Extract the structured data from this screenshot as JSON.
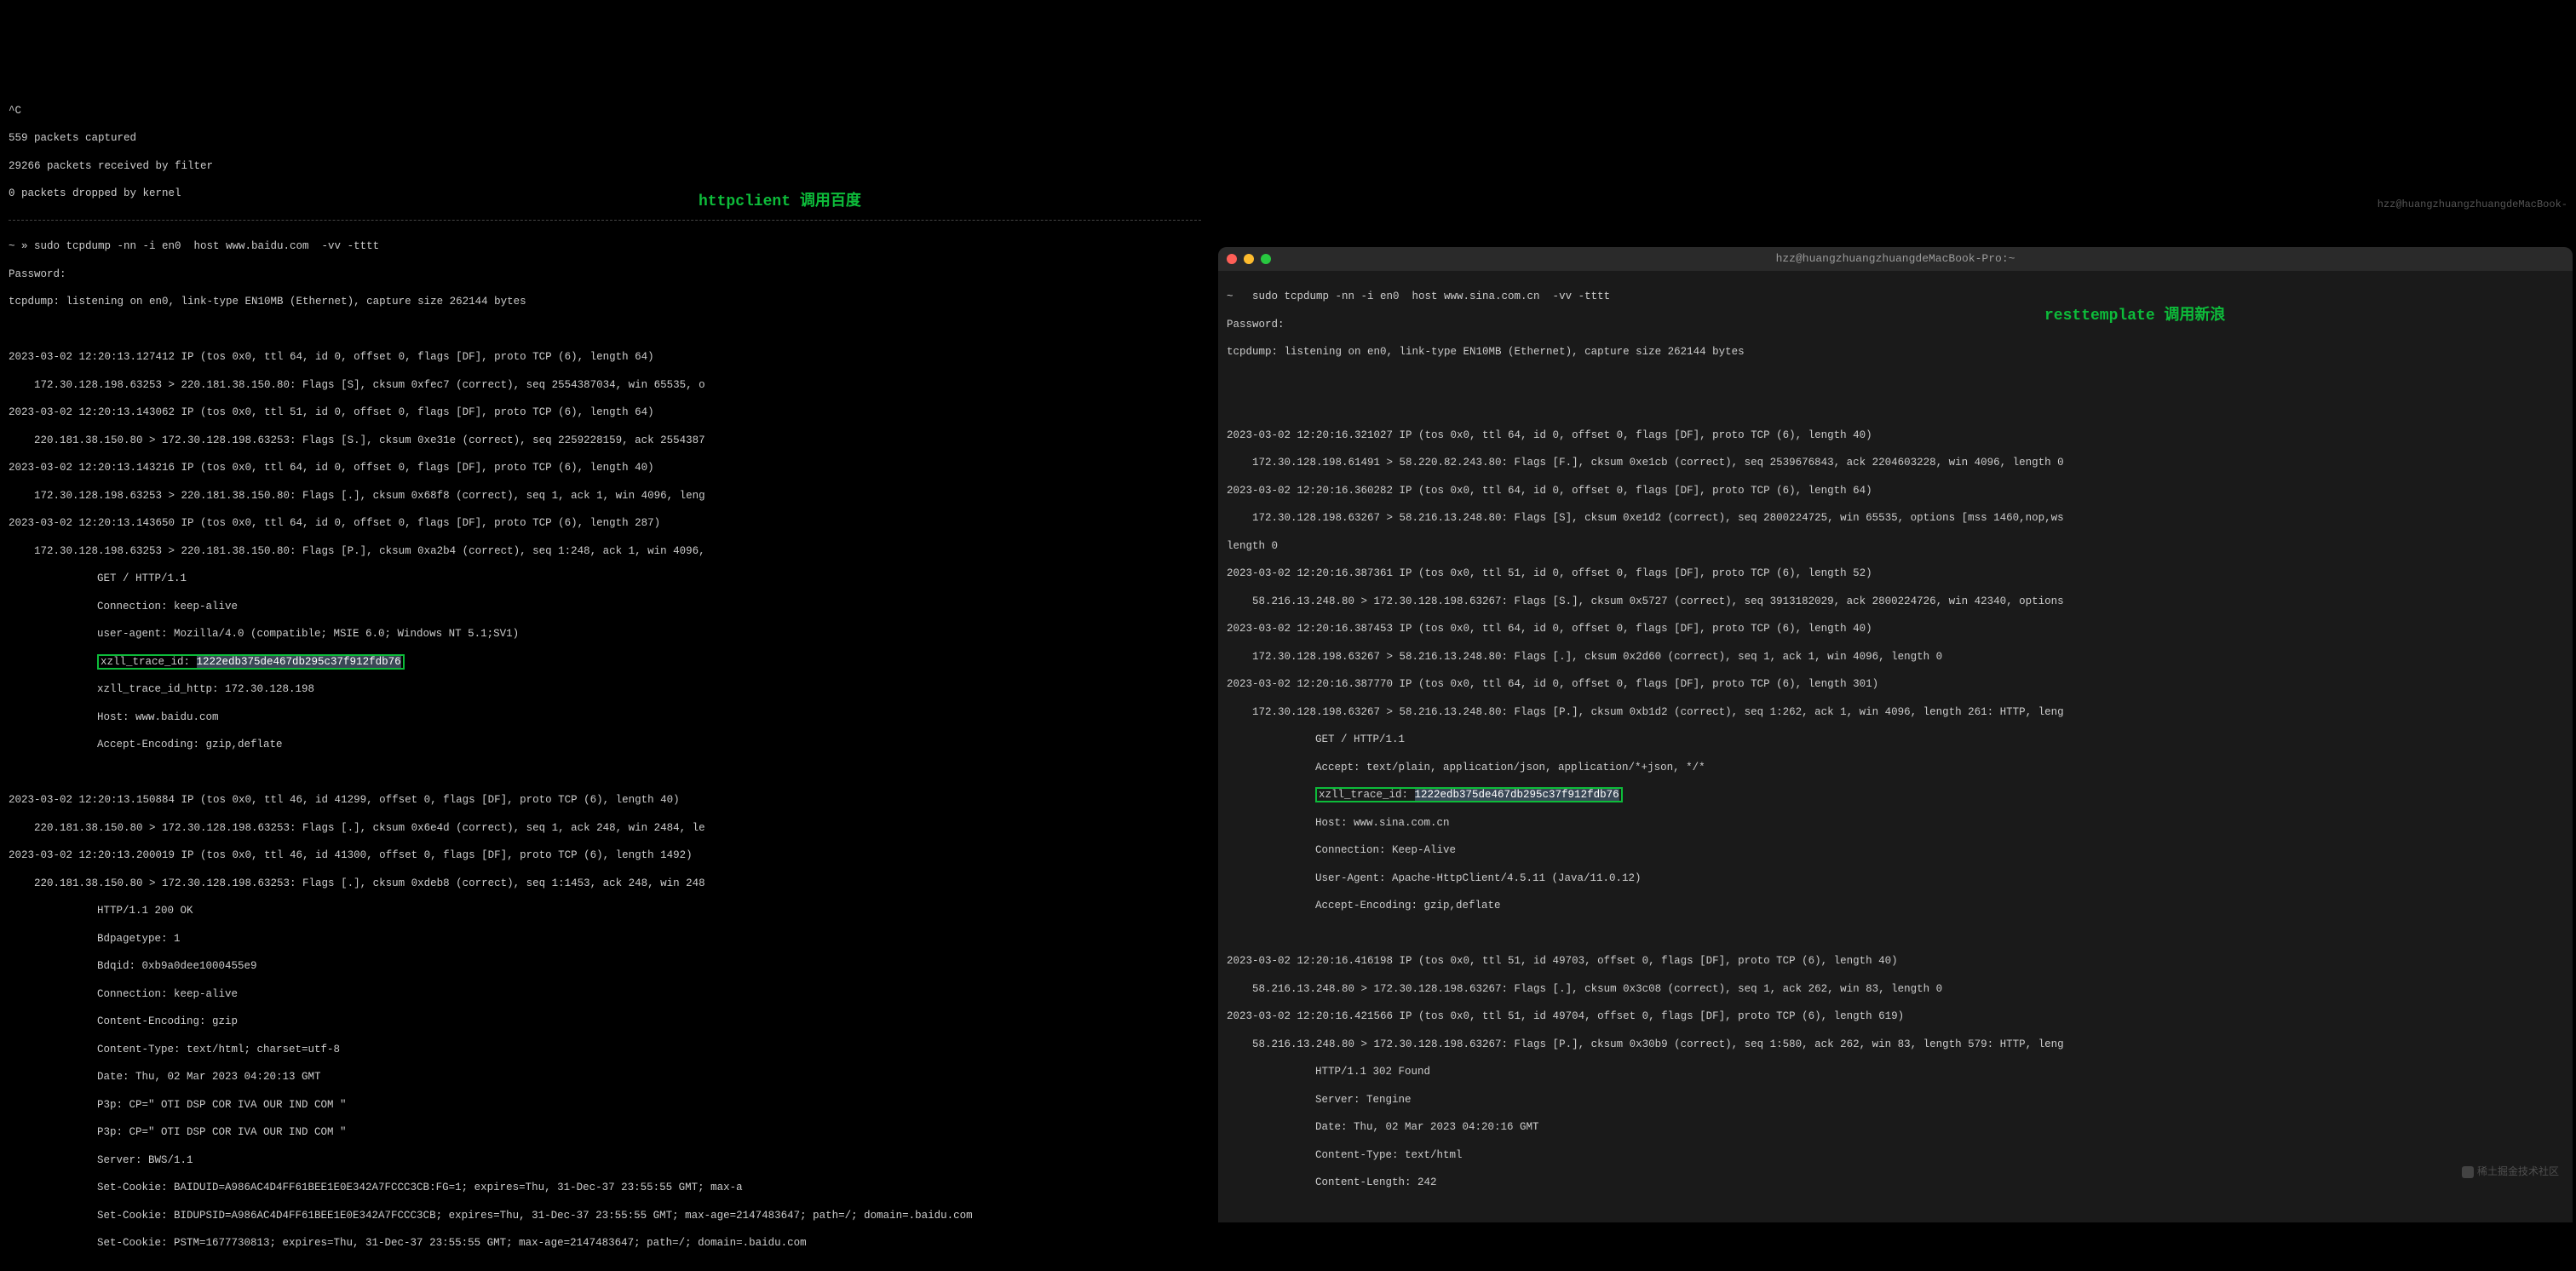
{
  "annotation_left": "httpclient 调用百度",
  "annotation_right": "resttemplate 调用新浪",
  "faded_host": "hzz@huangzhuangzhuangdeMacBook-",
  "watermark": "稀土掘金技术社区",
  "left": {
    "interrupt": "^C",
    "stats": [
      "559 packets captured",
      "29266 packets received by filter",
      "0 packets dropped by kernel"
    ],
    "prompt": "~ » sudo tcpdump -nn -i en0  host www.baidu.com  -vv -tttt",
    "password": "Password:",
    "listening": "tcpdump: listening on en0, link-type EN10MB (Ethernet), capture size 262144 bytes",
    "packets": [
      {
        "l": "2023-03-02 12:20:13.127412 IP (tos 0x0, ttl 64, id 0, offset 0, flags [DF], proto TCP (6), length 64)"
      },
      {
        "l": "    172.30.128.198.63253 > 220.181.38.150.80: Flags [S], cksum 0xfec7 (correct), seq 2554387034, win 65535, o"
      },
      {
        "l": "2023-03-02 12:20:13.143062 IP (tos 0x0, ttl 51, id 0, offset 0, flags [DF], proto TCP (6), length 64)"
      },
      {
        "l": "    220.181.38.150.80 > 172.30.128.198.63253: Flags [S.], cksum 0xe31e (correct), seq 2259228159, ack 2554387"
      },
      {
        "l": "2023-03-02 12:20:13.143216 IP (tos 0x0, ttl 64, id 0, offset 0, flags [DF], proto TCP (6), length 40)"
      },
      {
        "l": "    172.30.128.198.63253 > 220.181.38.150.80: Flags [.], cksum 0x68f8 (correct), seq 1, ack 1, win 4096, leng"
      },
      {
        "l": "2023-03-02 12:20:13.143650 IP (tos 0x0, ttl 64, id 0, offset 0, flags [DF], proto TCP (6), length 287)"
      },
      {
        "l": "    172.30.128.198.63253 > 220.181.38.150.80: Flags [P.], cksum 0xa2b4 (correct), seq 1:248, ack 1, win 4096,"
      }
    ],
    "http_req": [
      "GET / HTTP/1.1",
      "Connection: keep-alive",
      "user-agent: Mozilla/4.0 (compatible; MSIE 6.0; Windows NT 5.1;SV1)"
    ],
    "trace_label": "xzll_trace_id: ",
    "trace_value": "1222edb375de467db295c37f912fdb76",
    "http_req2": [
      "xzll_trace_id_http: 172.30.128.198",
      "Host: www.baidu.com",
      "Accept-Encoding: gzip,deflate"
    ],
    "packets2": [
      {
        "l": "2023-03-02 12:20:13.150884 IP (tos 0x0, ttl 46, id 41299, offset 0, flags [DF], proto TCP (6), length 40)"
      },
      {
        "l": "    220.181.38.150.80 > 172.30.128.198.63253: Flags [.], cksum 0x6e4d (correct), seq 1, ack 248, win 2484, le"
      },
      {
        "l": "2023-03-02 12:20:13.200019 IP (tos 0x0, ttl 46, id 41300, offset 0, flags [DF], proto TCP (6), length 1492)"
      },
      {
        "l": "    220.181.38.150.80 > 172.30.128.198.63253: Flags [.], cksum 0xdeb8 (correct), seq 1:1453, ack 248, win 248"
      }
    ],
    "http_resp": [
      "HTTP/1.1 200 OK",
      "Bdpagetype: 1",
      "Bdqid: 0xb9a0dee1000455e9",
      "Connection: keep-alive",
      "Content-Encoding: gzip",
      "Content-Type: text/html; charset=utf-8",
      "Date: Thu, 02 Mar 2023 04:20:13 GMT",
      "P3p: CP=\" OTI DSP COR IVA OUR IND COM \"",
      "P3p: CP=\" OTI DSP COR IVA OUR IND COM \"",
      "Server: BWS/1.1",
      "Set-Cookie: BAIDUID=A986AC4D4FF61BEE1E0E342A7FCCC3CB:FG=1; expires=Thu, 31-Dec-37 23:55:55 GMT; max-a",
      "Set-Cookie: BIDUPSID=A986AC4D4FF61BEE1E0E342A7FCCC3CB; expires=Thu, 31-Dec-37 23:55:55 GMT; max-age=2147483647; path=/; domain=.baidu.com",
      "Set-Cookie: PSTM=1677730813; expires=Thu, 31-Dec-37 23:55:55 GMT; max-age=2147483647; path=/; domain=.baidu.com"
    ]
  },
  "right": {
    "window_title": "hzz@huangzhuangzhuangdeMacBook-Pro:~",
    "prompt": "~   sudo tcpdump -nn -i en0  host www.sina.com.cn  -vv -tttt",
    "password": "Password:",
    "listening": "tcpdump: listening on en0, link-type EN10MB (Ethernet), capture size 262144 bytes",
    "packets": [
      {
        "l": "2023-03-02 12:20:16.321027 IP (tos 0x0, ttl 64, id 0, offset 0, flags [DF], proto TCP (6), length 40)"
      },
      {
        "l": "    172.30.128.198.61491 > 58.220.82.243.80: Flags [F.], cksum 0xe1cb (correct), seq 2539676843, ack 2204603228, win 4096, length 0"
      },
      {
        "l": "2023-03-02 12:20:16.360282 IP (tos 0x0, ttl 64, id 0, offset 0, flags [DF], proto TCP (6), length 64)"
      },
      {
        "l": "    172.30.128.198.63267 > 58.216.13.248.80: Flags [S], cksum 0xe1d2 (correct), seq 2800224725, win 65535, options [mss 1460,nop,ws"
      },
      {
        "l": "length 0"
      },
      {
        "l": "2023-03-02 12:20:16.387361 IP (tos 0x0, ttl 51, id 0, offset 0, flags [DF], proto TCP (6), length 52)"
      },
      {
        "l": "    58.216.13.248.80 > 172.30.128.198.63267: Flags [S.], cksum 0x5727 (correct), seq 3913182029, ack 2800224726, win 42340, options"
      },
      {
        "l": "2023-03-02 12:20:16.387453 IP (tos 0x0, ttl 64, id 0, offset 0, flags [DF], proto TCP (6), length 40)"
      },
      {
        "l": "    172.30.128.198.63267 > 58.216.13.248.80: Flags [.], cksum 0x2d60 (correct), seq 1, ack 1, win 4096, length 0"
      },
      {
        "l": "2023-03-02 12:20:16.387770 IP (tos 0x0, ttl 64, id 0, offset 0, flags [DF], proto TCP (6), length 301)"
      },
      {
        "l": "    172.30.128.198.63267 > 58.216.13.248.80: Flags [P.], cksum 0xb1d2 (correct), seq 1:262, ack 1, win 4096, length 261: HTTP, leng"
      }
    ],
    "http_req": [
      "GET / HTTP/1.1",
      "Accept: text/plain, application/json, application/*+json, */*"
    ],
    "trace_label": "xzll_trace_id: ",
    "trace_value": "1222edb375de467db295c37f912fdb76",
    "http_req2": [
      "Host: www.sina.com.cn",
      "Connection: Keep-Alive",
      "User-Agent: Apache-HttpClient/4.5.11 (Java/11.0.12)",
      "Accept-Encoding: gzip,deflate"
    ],
    "packets2": [
      {
        "l": "2023-03-02 12:20:16.416198 IP (tos 0x0, ttl 51, id 49703, offset 0, flags [DF], proto TCP (6), length 40)"
      },
      {
        "l": "    58.216.13.248.80 > 172.30.128.198.63267: Flags [.], cksum 0x3c08 (correct), seq 1, ack 262, win 83, length 0"
      },
      {
        "l": "2023-03-02 12:20:16.421566 IP (tos 0x0, ttl 51, id 49704, offset 0, flags [DF], proto TCP (6), length 619)"
      },
      {
        "l": "    58.216.13.248.80 > 172.30.128.198.63267: Flags [P.], cksum 0x30b9 (correct), seq 1:580, ack 262, win 83, length 579: HTTP, leng"
      }
    ],
    "http_resp": [
      "HTTP/1.1 302 Found",
      "Server: Tengine",
      "Date: Thu, 02 Mar 2023 04:20:16 GMT",
      "Content-Type: text/html",
      "Content-Length: 242"
    ]
  }
}
